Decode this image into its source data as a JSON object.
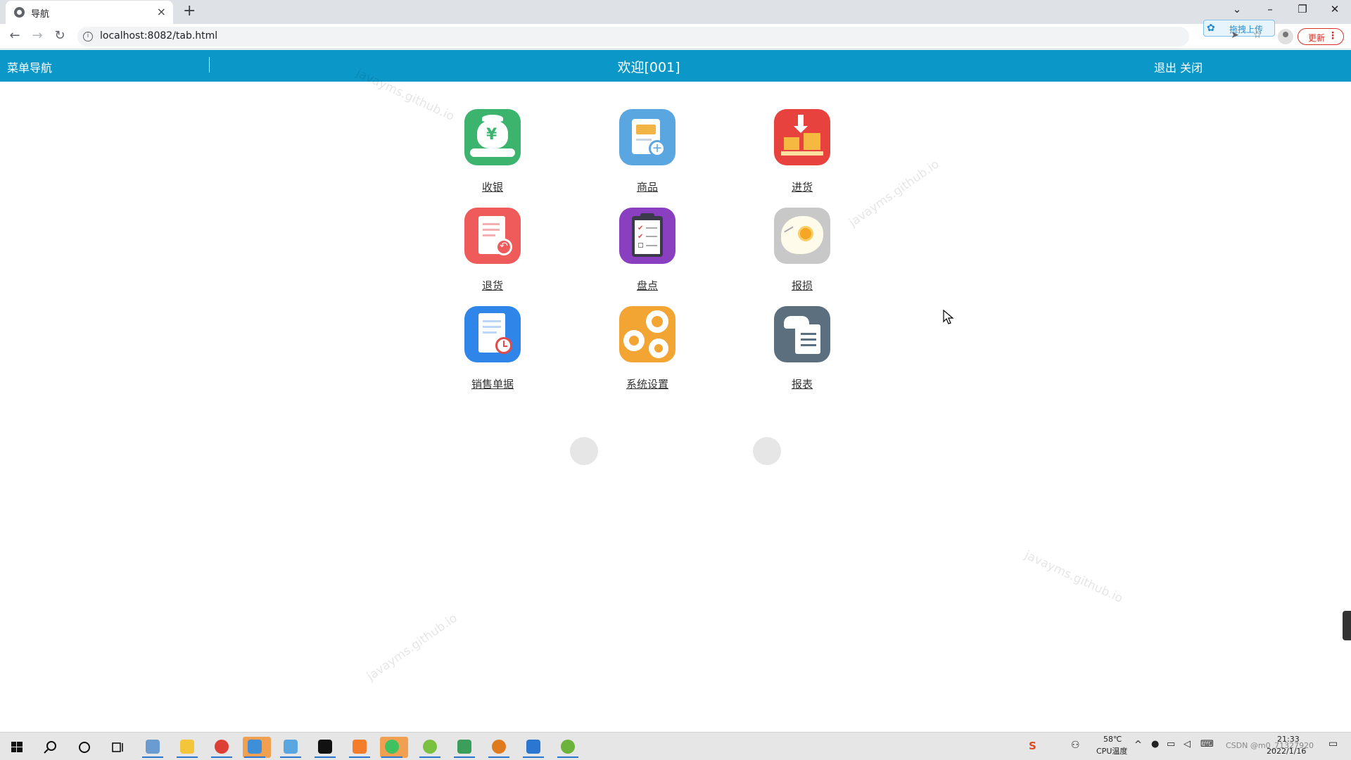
{
  "browser": {
    "tab_title": "导航",
    "tab_close": "×",
    "new_tab": "+",
    "url": "localhost:8082/tab.html",
    "upload_label": "拖拽上传",
    "update_label": "更新"
  },
  "header": {
    "menu_nav": "菜单导航",
    "welcome": "欢迎[001]",
    "logout": "退出",
    "close": "关闭"
  },
  "menu": [
    {
      "label": "收银",
      "icon": "money-bag-icon",
      "color": "#3cb46e"
    },
    {
      "label": "商品",
      "icon": "product-add-icon",
      "color": "#5aa6e0"
    },
    {
      "label": "进货",
      "icon": "stock-in-icon",
      "color": "#e8423f"
    },
    {
      "label": "退货",
      "icon": "return-receipt-icon",
      "color": "#ef5b5b"
    },
    {
      "label": "盘点",
      "icon": "clipboard-checklist-icon",
      "color": "#8a3fc0"
    },
    {
      "label": "报损",
      "icon": "broken-egg-icon",
      "color": "#c8c8c8"
    },
    {
      "label": "销售单据",
      "icon": "sales-receipt-clock-icon",
      "color": "#2f86e8"
    },
    {
      "label": "系统设置",
      "icon": "gears-icon",
      "color": "#f2a532"
    },
    {
      "label": "报表",
      "icon": "report-cloud-icon",
      "color": "#5b6f7e"
    }
  ],
  "watermark_text": "javayms.github.io",
  "taskbar": {
    "temp": "58℃",
    "temp_label": "CPU温度",
    "time": "21:33",
    "date": "2022/1/16",
    "csdn": "CSDN @m0_71327920"
  }
}
